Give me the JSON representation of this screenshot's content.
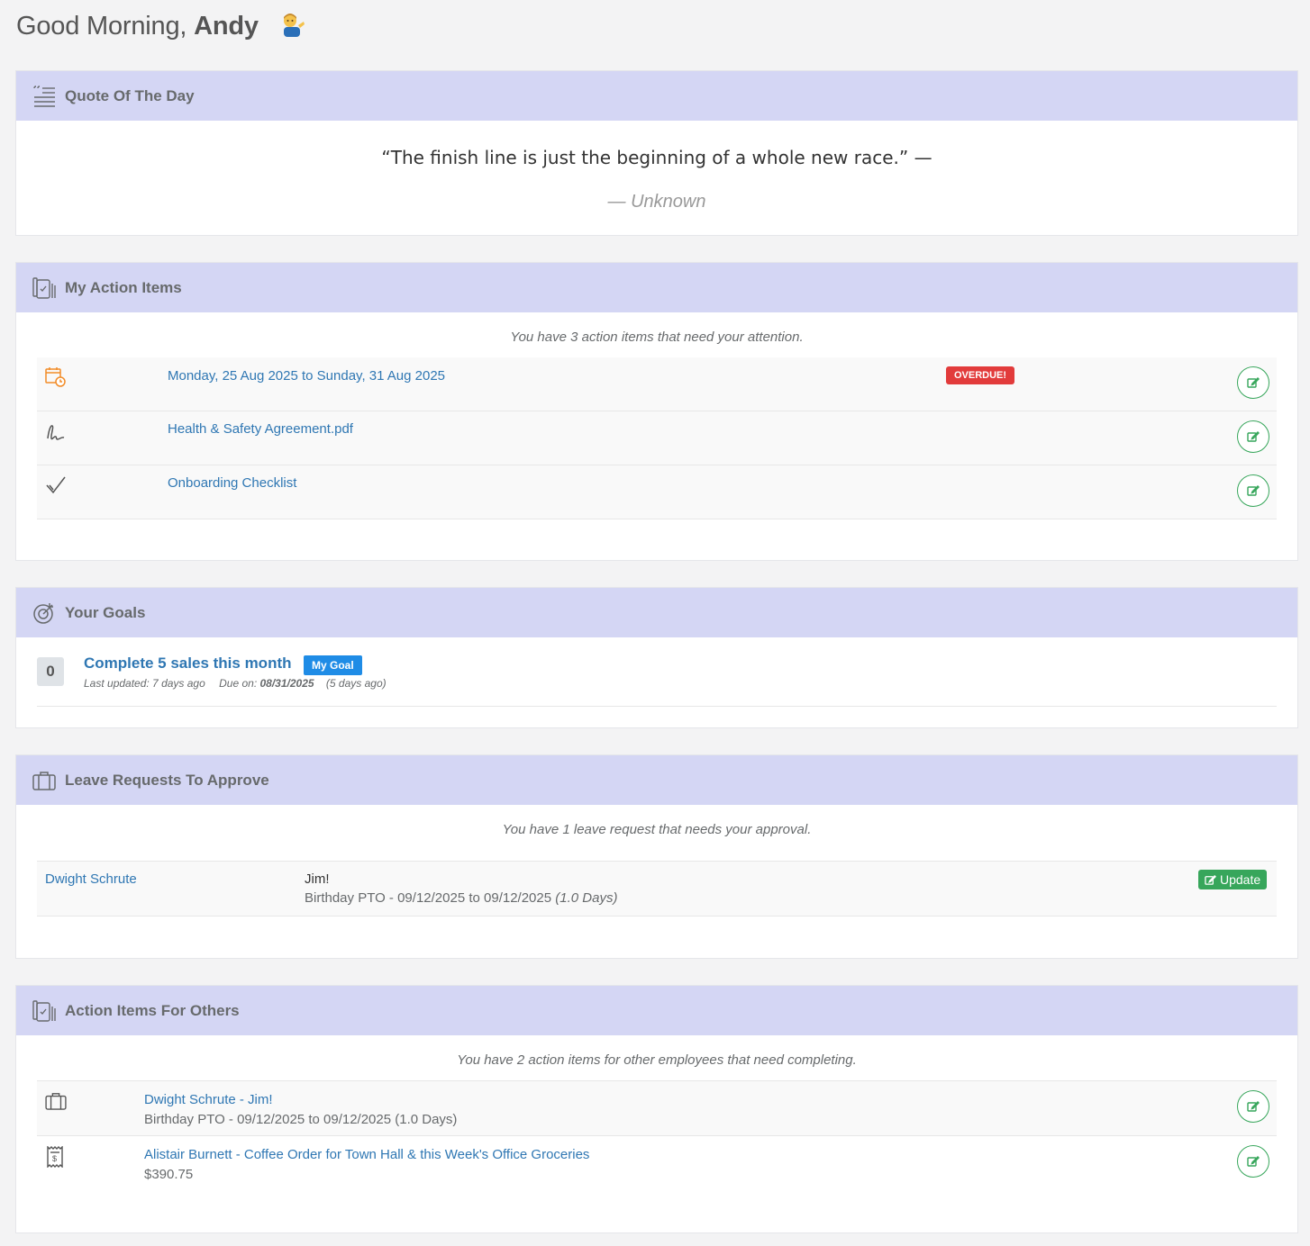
{
  "greeting": {
    "prefix": "Good Morning,",
    "name": "Andy"
  },
  "quote": {
    "title": "Quote Of The Day",
    "text": "“The finish line is just the beginning of a whole new race.” —",
    "author": "— Unknown"
  },
  "my_actions": {
    "title": "My Action Items",
    "summary": "You have 3 action items that need your attention.",
    "items": [
      {
        "icon": "calendar-clock-icon",
        "label": "Monday, 25 Aug 2025 to Sunday, 31 Aug 2025",
        "badge": "OVERDUE!"
      },
      {
        "icon": "signature-icon",
        "label": "Health & Safety Agreement.pdf"
      },
      {
        "icon": "checkmark-icon",
        "label": "Onboarding Checklist"
      }
    ]
  },
  "goals": {
    "title": "Your Goals",
    "items": [
      {
        "progress": "0",
        "name": "Complete 5 sales this month",
        "tag": "My Goal",
        "last_updated": "Last updated: 7 days ago",
        "due_label": "Due on:",
        "due_date": "08/31/2025",
        "due_relative": "(5 days ago)"
      }
    ]
  },
  "leave": {
    "title": "Leave Requests To Approve",
    "summary": "You have 1 leave request that needs your approval.",
    "items": [
      {
        "employee": "Dwight Schrute",
        "note": "Jim!",
        "detail": "Birthday PTO - 09/12/2025 to 09/12/2025",
        "days": "(1.0 Days)",
        "button": "Update"
      }
    ]
  },
  "others": {
    "title": "Action Items For Others",
    "summary": "You have 2 action items for other employees that need completing.",
    "items": [
      {
        "icon": "briefcase-icon",
        "label": "Dwight Schrute - Jim!",
        "sub": "Birthday PTO - 09/12/2025 to 09/12/2025 (1.0 Days)"
      },
      {
        "icon": "receipt-icon",
        "label": "Alistair Burnett - Coffee Order for Town Hall & this Week's Office Groceries",
        "sub": "$390.75"
      }
    ]
  },
  "colors": {
    "header_bg": "#d4d6f4",
    "link": "#2f77b3",
    "success": "#37a65b",
    "danger": "#e23b3b",
    "tag": "#1f8ce6"
  }
}
